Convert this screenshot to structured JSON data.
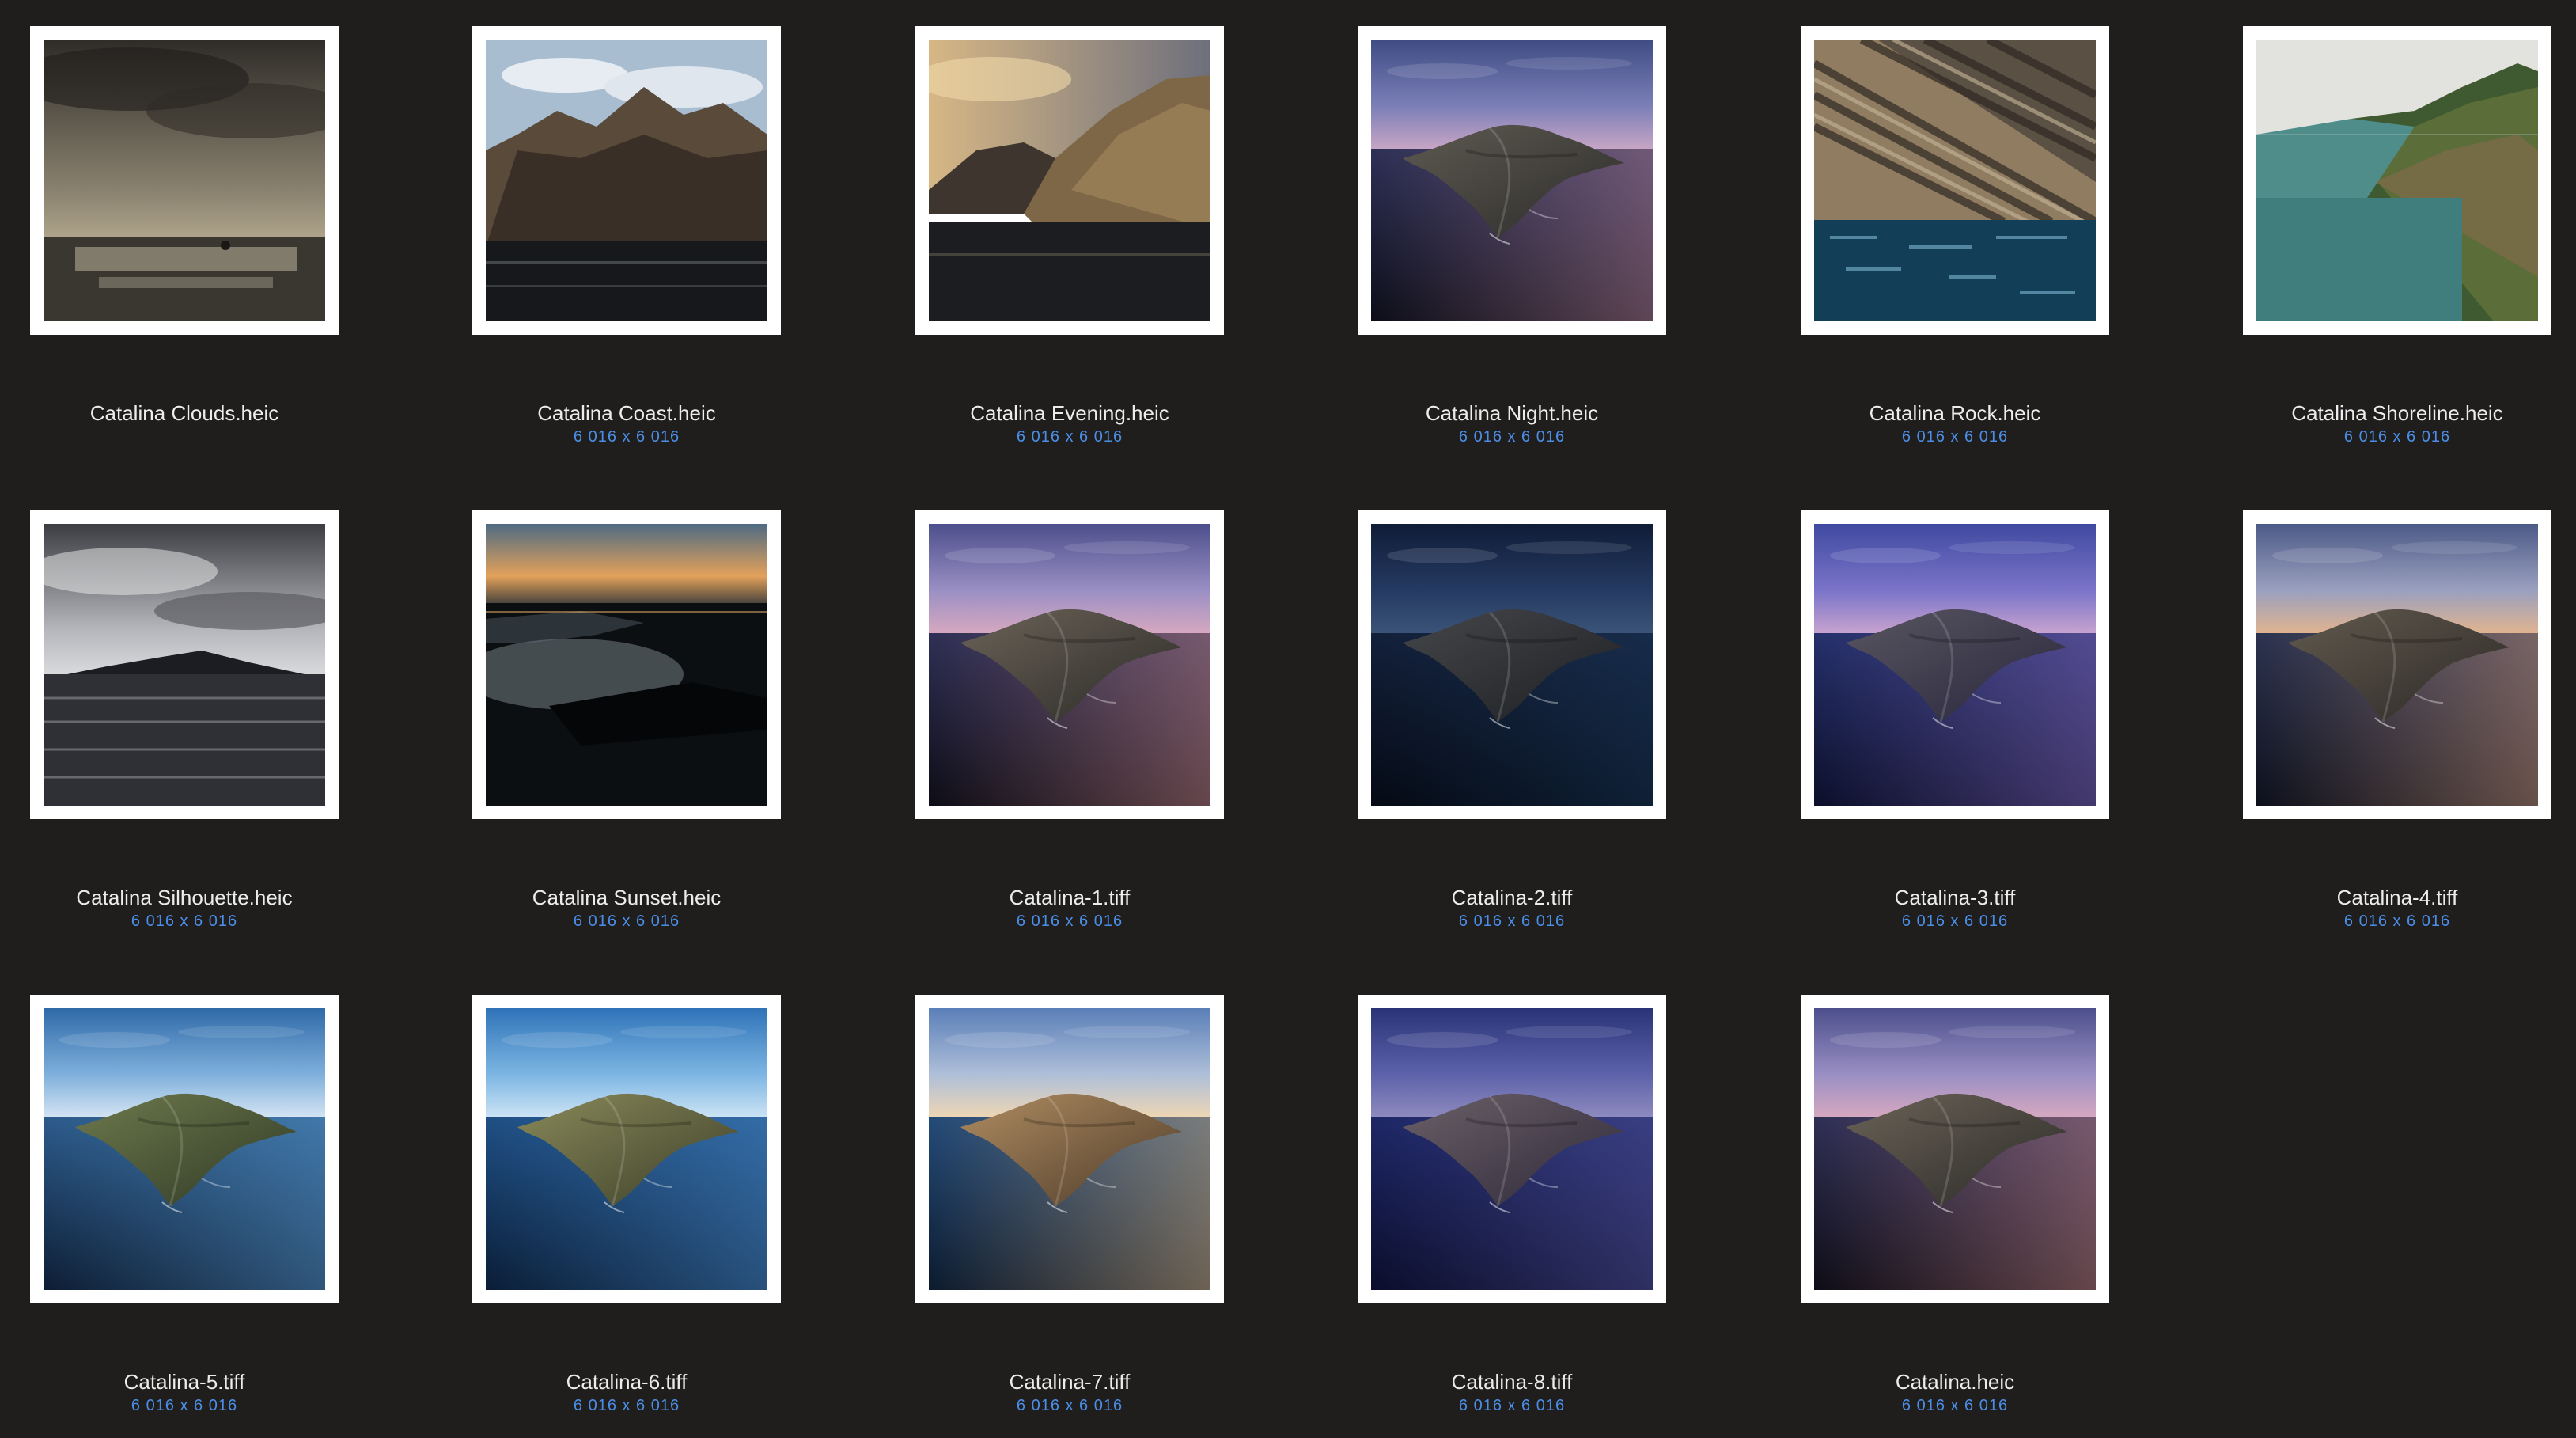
{
  "window": {
    "view": "icon-grid"
  },
  "colors": {
    "background": "#1f1e1d",
    "thumb_border": "#ffffff",
    "label_text": "#ececec",
    "dimension_text": "#4b8ee8"
  },
  "files": [
    {
      "name": "Catalina Clouds.heic",
      "dimensions": "",
      "scene": "clouds"
    },
    {
      "name": "Catalina Coast.heic",
      "dimensions": "6 016 x 6 016",
      "scene": "coast"
    },
    {
      "name": "Catalina Evening.heic",
      "dimensions": "6 016 x 6 016",
      "scene": "evening"
    },
    {
      "name": "Catalina Night.heic",
      "dimensions": "6 016 x 6 016",
      "scene": "night"
    },
    {
      "name": "Catalina Rock.heic",
      "dimensions": "6 016 x 6 016",
      "scene": "rock"
    },
    {
      "name": "Catalina Shoreline.heic",
      "dimensions": "6 016 x 6 016",
      "scene": "shoreline"
    },
    {
      "name": "Catalina Silhouette.heic",
      "dimensions": "6 016 x 6 016",
      "scene": "silhouette"
    },
    {
      "name": "Catalina Sunset.heic",
      "dimensions": "6 016 x 6 016",
      "scene": "sunset"
    },
    {
      "name": "Catalina-1.tiff",
      "dimensions": "6 016 x 6 016",
      "scene": "island-dusk"
    },
    {
      "name": "Catalina-2.tiff",
      "dimensions": "6 016 x 6 016",
      "scene": "island-night"
    },
    {
      "name": "Catalina-3.tiff",
      "dimensions": "6 016 x 6 016",
      "scene": "island-violet"
    },
    {
      "name": "Catalina-4.tiff",
      "dimensions": "6 016 x 6 016",
      "scene": "island-dawn"
    },
    {
      "name": "Catalina-5.tiff",
      "dimensions": "6 016 x 6 016",
      "scene": "island-day"
    },
    {
      "name": "Catalina-6.tiff",
      "dimensions": "6 016 x 6 016",
      "scene": "island-noon"
    },
    {
      "name": "Catalina-7.tiff",
      "dimensions": "6 016 x 6 016",
      "scene": "island-golden"
    },
    {
      "name": "Catalina-8.tiff",
      "dimensions": "6 016 x 6 016",
      "scene": "island-blue"
    },
    {
      "name": "Catalina.heic",
      "dimensions": "6 016 x 6 016",
      "scene": "island-dusk"
    }
  ]
}
